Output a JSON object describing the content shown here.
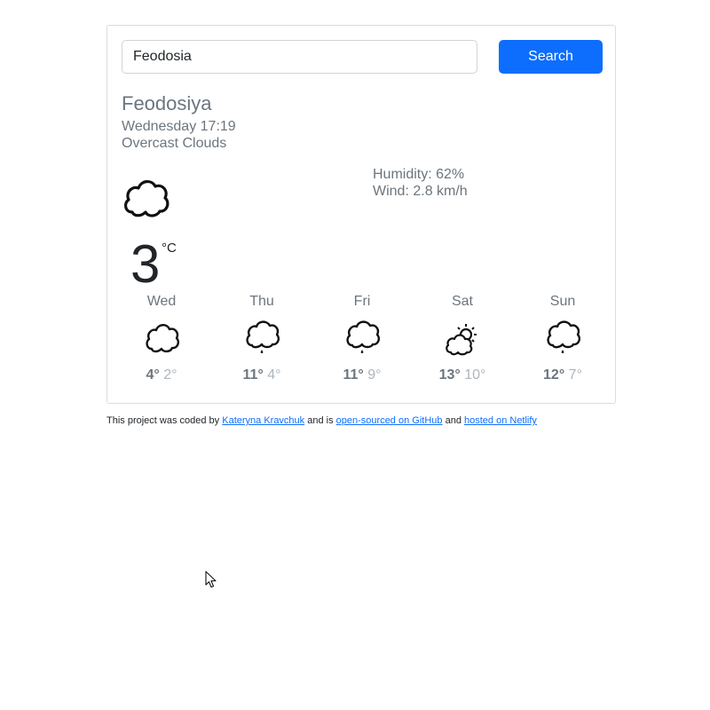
{
  "search": {
    "value": "Feodosia",
    "button_label": "Search"
  },
  "current": {
    "city": "Feodosiya",
    "datetime": "Wednesday 17:19",
    "condition": "Overcast Clouds",
    "icon": "cloud-icon",
    "temperature": "3",
    "unit": "°C",
    "humidity": "Humidity: 62%",
    "wind": "Wind: 2.8 km/h"
  },
  "forecast": [
    {
      "day": "Wed",
      "icon": "cloud-icon",
      "max": "4°",
      "min": "2°"
    },
    {
      "day": "Thu",
      "icon": "rain-cloud-icon",
      "max": "11°",
      "min": "4°"
    },
    {
      "day": "Fri",
      "icon": "rain-cloud-icon",
      "max": "11°",
      "min": "9°"
    },
    {
      "day": "Sat",
      "icon": "partly-sunny-icon",
      "max": "13°",
      "min": "10°"
    },
    {
      "day": "Sun",
      "icon": "rain-cloud-icon",
      "max": "12°",
      "min": "7°"
    }
  ],
  "footer": {
    "prefix": "This project was coded by",
    "author_link": "Kateryna Kravchuk",
    "middle": "and is",
    "github_link": "open-sourced on GitHub",
    "and": "and",
    "netlify_link": "hosted on Netlify"
  },
  "colors": {
    "accent": "#0d6efd",
    "muted_text": "#6c757d",
    "light_text": "#adb5bd"
  }
}
